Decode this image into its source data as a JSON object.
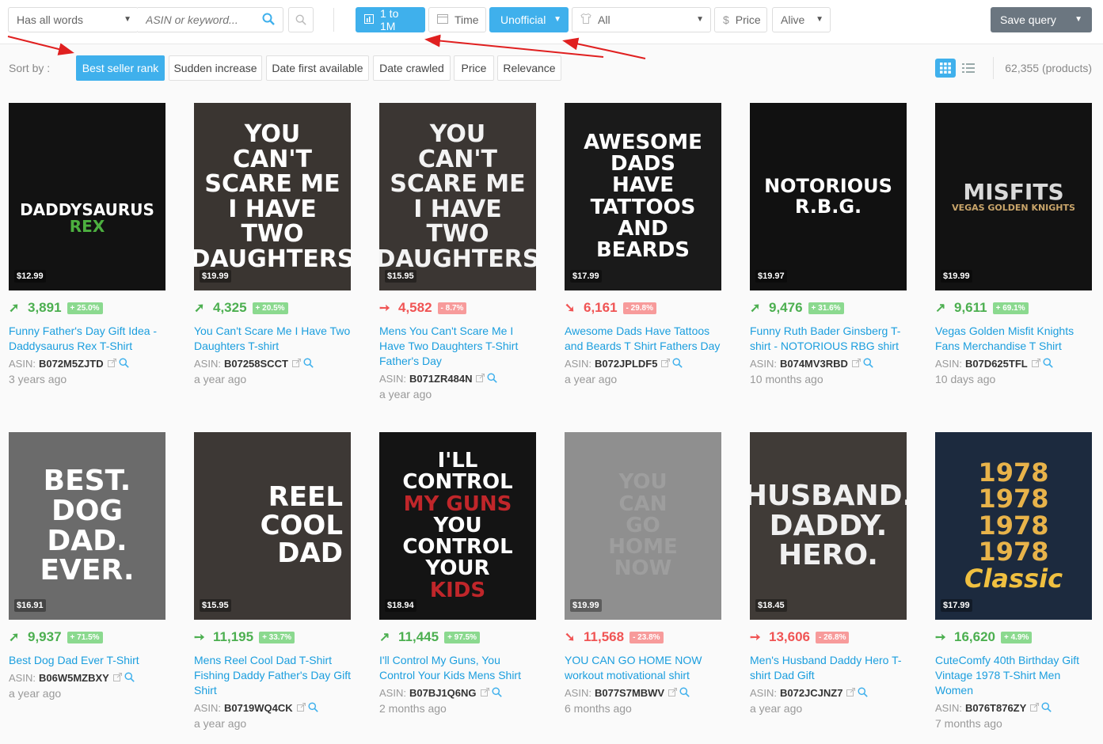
{
  "toolbar": {
    "match_mode": "Has all words",
    "search_placeholder": "ASIN or keyword...",
    "rank_range": "1 to 1M",
    "time": "Time",
    "listing_type": "Unofficial",
    "category": "All",
    "price": "Price",
    "status": "Alive",
    "save_query": "Save query"
  },
  "sort": {
    "label": "Sort by :",
    "options": [
      "Best seller rank",
      "Sudden increase",
      "Date first available",
      "Date crawled",
      "Price",
      "Relevance"
    ],
    "active": "Best seller rank"
  },
  "results_count": "62,355 (products)",
  "colors": {
    "accent": "#3fb0ec",
    "up": "#4caf50",
    "down": "#f05454",
    "link": "#1b9ede"
  },
  "products": [
    {
      "price": "$12.99",
      "rank": "3,891",
      "change": "+ 25.0%",
      "trend": "up",
      "title": "Funny Father's Day Gift Idea - Daddysaurus Rex T-Shirt",
      "asin": "B072M5ZJTD",
      "ago": "3 years ago",
      "art": [
        "DADDYSAURUS",
        "REX"
      ],
      "bg": "#121212",
      "fg": "#ffffff"
    },
    {
      "price": "$19.99",
      "rank": "4,325",
      "change": "+ 20.5%",
      "trend": "up",
      "title": "You Can't Scare Me I Have Two Daughters T-shirt",
      "asin": "B07258SCCT",
      "ago": "a year ago",
      "art": [
        "YOU CAN'T",
        "SCARE ME",
        "I HAVE TWO",
        "DAUGHTERS"
      ],
      "bg": "#3a3531",
      "fg": "#ffffff"
    },
    {
      "price": "$15.95",
      "rank": "4,582",
      "change": "- 8.7%",
      "trend": "flat-down",
      "title": "Mens You Can't Scare Me I Have Two Daughters T-Shirt Father's Day",
      "asin": "B071ZR484N",
      "ago": "a year ago",
      "art": [
        "YOU CAN'T",
        "SCARE ME",
        "I HAVE TWO",
        "DAUGHTERS"
      ],
      "bg": "#3b3633",
      "fg": "#f3f3f3"
    },
    {
      "price": "$17.99",
      "rank": "6,161",
      "change": "- 29.8%",
      "trend": "down",
      "title": "Awesome Dads Have Tattoos and Beards T Shirt Fathers Day",
      "asin": "B072JPLDF5",
      "ago": "a year ago",
      "art": [
        "AWESOME",
        "DADS",
        "HAVE",
        "TATTOOS",
        "AND",
        "BEARDS"
      ],
      "bg": "#1a1a1a",
      "fg": "#ffffff"
    },
    {
      "price": "$19.97",
      "rank": "9,476",
      "change": "+ 31.6%",
      "trend": "up",
      "title": "Funny Ruth Bader Ginsberg T-shirt - NOTORIOUS RBG shirt",
      "asin": "B074MV3RBD",
      "ago": "10 months ago",
      "art": [
        "NOTORIOUS",
        "R.B.G."
      ],
      "bg": "#111111",
      "fg": "#ffffff"
    },
    {
      "price": "$19.99",
      "rank": "9,611",
      "change": "+ 69.1%",
      "trend": "up-steep",
      "title": "Vegas Golden Misfit Knights Fans Merchandise T Shirt",
      "asin": "B07D625TFL",
      "ago": "10 days ago",
      "art": [
        "MISFITS",
        "VEGAS GOLDEN KNIGHTS"
      ],
      "bg": "#121212",
      "fg": "#d9d9d9"
    },
    {
      "price": "$16.91",
      "rank": "9,937",
      "change": "+ 71.5%",
      "trend": "up",
      "title": "Best Dog Dad Ever T-Shirt",
      "asin": "B06W5MZBXY",
      "ago": "a year ago",
      "art": [
        "BEST.",
        "DOG DAD.",
        "EVER."
      ],
      "bg": "#6b6b6b",
      "fg": "#ffffff"
    },
    {
      "price": "$15.95",
      "rank": "11,195",
      "change": "+ 33.7%",
      "trend": "flat-up",
      "title": "Mens Reel Cool Dad T-Shirt Fishing Daddy Father's Day Gift Shirt",
      "asin": "B0719WQ4CK",
      "ago": "a year ago",
      "art": [
        "REEL",
        "COOL",
        "DAD"
      ],
      "bg": "#3d3835",
      "fg": "#ffffff"
    },
    {
      "price": "$18.94",
      "rank": "11,445",
      "change": "+ 97.5%",
      "trend": "up-steep",
      "title": "I'll Control My Guns, You Control Your Kids Mens Shirt",
      "asin": "B07BJ1Q6NG",
      "ago": "2 months ago",
      "art": [
        "I'LL CONTROL",
        "MY GUNS",
        "YOU CONTROL",
        "YOUR",
        "KIDS"
      ],
      "bg": "#141414",
      "fg": "#ffffff"
    },
    {
      "price": "$19.99",
      "rank": "11,568",
      "change": "- 23.8%",
      "trend": "down",
      "title": "YOU CAN GO HOME NOW workout motivational shirt",
      "asin": "B077S7MBWV",
      "ago": "6 months ago",
      "art": [
        "YOU",
        "CAN",
        "GO",
        "HOME",
        "NOW"
      ],
      "bg": "#8f8f8f",
      "fg": "#9e9e9e"
    },
    {
      "price": "$18.45",
      "rank": "13,606",
      "change": "- 26.8%",
      "trend": "flat-down",
      "title": "Men's Husband Daddy Hero T-shirt Dad Gift",
      "asin": "B072JCJNZ7",
      "ago": "a year ago",
      "art": [
        "HUSBAND.",
        "DADDY.",
        "HERO."
      ],
      "bg": "#403b37",
      "fg": "#f0f0f0"
    },
    {
      "price": "$17.99",
      "rank": "16,620",
      "change": "+ 4.9%",
      "trend": "flat-up",
      "title": "CuteComfy 40th Birthday Gift Vintage 1978 T-Shirt Men Women",
      "asin": "B076T876ZY",
      "ago": "7 months ago",
      "art": [
        "1978",
        "1978",
        "1978",
        "1978",
        "Classic"
      ],
      "bg": "#1c2a3e",
      "fg": "#e8b34a"
    }
  ]
}
